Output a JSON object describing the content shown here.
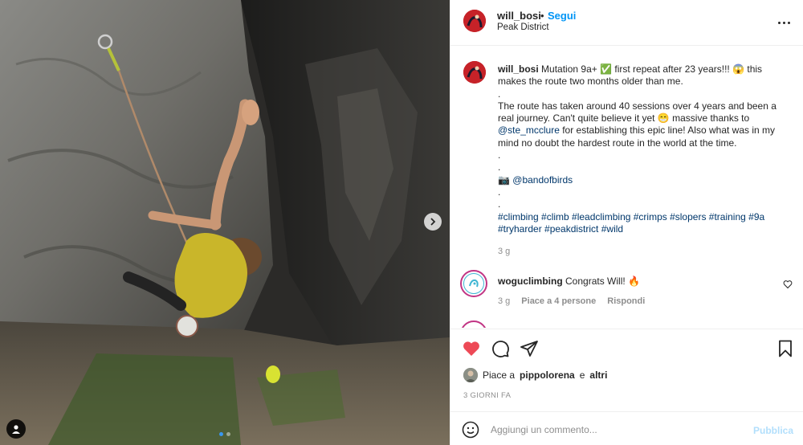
{
  "post": {
    "username": "will_bosi",
    "dot": "•",
    "follow_label": "Segui",
    "location": "Peak District",
    "photo_dots": 2,
    "active_dot": 1
  },
  "caption": {
    "username": "will_bosi",
    "lines": [
      "Mutation 9a+ ✅ first repeat after 23 years!!! 😱 this",
      "makes the route two months older than me.",
      ".",
      "The route has taken around 40 sessions over 4 years and been a",
      "real journey. Can't quite believe it yet 😁 massive thanks to",
      "@ste_mcclure for establishing this epic line! Also what was in my",
      "mind no doubt the hardest route in the world at the time.",
      ".",
      ".",
      "📷 @bandofbirds",
      ".",
      ".",
      "#climbing #climb #leadclimbing #crimps #slopers #training #9a",
      "#tryharder #peakdistrict #wild"
    ],
    "time": "3 g"
  },
  "comment": {
    "username": "woguclimbing",
    "text": "Congrats Will! 🔥",
    "time": "3 g",
    "likes_label": "Piace a 4 persone",
    "reply_label": "Rispondi"
  },
  "likes": {
    "prefix": "Piace a",
    "user": "pippolorena",
    "joiner": "e",
    "others": "altri"
  },
  "date_label": "3 GIORNI FA",
  "add_comment": {
    "placeholder": "Aggiungi un commento...",
    "post_label": "Pubblica"
  },
  "colors": {
    "link": "#00376b",
    "follow": "#0095f6",
    "like_red": "#ed4956",
    "post_disabled": "#b2dffc"
  },
  "icons": [
    "next-arrow-icon",
    "user-tag-icon",
    "more-options-icon",
    "heart-icon",
    "comment-icon",
    "share-icon",
    "save-icon",
    "emoji-icon"
  ]
}
